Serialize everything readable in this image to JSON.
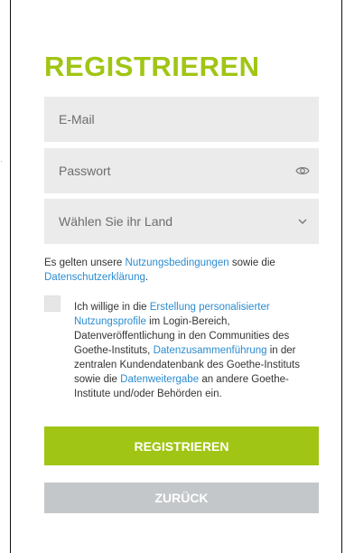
{
  "form": {
    "title": "REGISTRIEREN",
    "email_placeholder": "E-Mail",
    "password_placeholder": "Passwort",
    "country_placeholder": "Wählen Sie ihr Land"
  },
  "terms": {
    "prefix": "Es gelten unsere",
    "terms_link": "Nutzungsbedingungen",
    "middle": "sowie die",
    "privacy_link": "Datenschutzerklärung",
    "suffix": "."
  },
  "consent": {
    "part1": "Ich willige in die",
    "link1": "Erstellung personalisierter Nutzungsprofile",
    "part2": "im Login-Bereich, Datenveröffentlichung in den Communities des Goethe-Instituts,",
    "link2": "Datenzusammenführung",
    "part3": "in der zentralen Kundendatenbank des Goethe-Instituts sowie die",
    "link3": "Datenweitergabe",
    "part4": "an andere Goethe-Institute und/oder Behörden ein."
  },
  "buttons": {
    "register": "REGISTRIEREN",
    "back": "ZURÜCK"
  },
  "icons": {
    "password_toggle": "eye-icon",
    "country_dropdown": "chevron-down-icon"
  },
  "colors": {
    "accent": "#a0c514",
    "link": "#2b8cd0",
    "field_background": "#ebebeb",
    "secondary_button": "#c4c7c9"
  }
}
